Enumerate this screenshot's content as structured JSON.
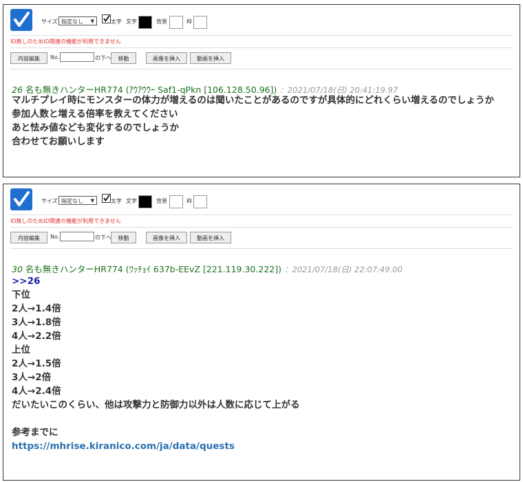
{
  "toolbar": {
    "size_label": "サイズ",
    "size_value": "指定なし",
    "bold_label": "太字",
    "text_label": "文字",
    "bg_label": "背景",
    "border_label": "枠",
    "warning": "ID無しのためID関連の機能が利用できません",
    "edit_button": "内容編集",
    "no_label": "No.",
    "below_label": "の下へ",
    "move_button": "移動",
    "insert_image_button": "画像を挿入",
    "insert_video_button": "動画を挿入"
  },
  "colors": {
    "text_swatch": "#000000",
    "bg_swatch": "#ffffff",
    "border_swatch": "#ffffff",
    "name": "#1a6f1a",
    "warning": "#e03030",
    "logo": "#1e6fd0"
  },
  "posts": [
    {
      "number": "26",
      "author": "名も無きハンターHR774 (ｱｳｱｳｳｰ Saf1-qPkn [106.128.50.96])",
      "date": "：2021/07/18(日) 20:41:19.97",
      "lines": [
        "マルチプレイ時にモンスターの体力が増えるのは聞いたことがあるのですが具体的にどれくらい増えるのでしょうか",
        "参加人数と増える倍率を教えてください",
        "あと怯み値なども変化するのでしょうか",
        "合わせてお願いします"
      ]
    },
    {
      "number": "30",
      "author": "名も無きハンターHR774 (ﾜｯﾁｮｲ 637b-EEvZ [221.119.30.222])",
      "date": "：2021/07/18(日) 22:07:49.00",
      "anchor": ">>26",
      "lines": [
        "下位",
        "2人→1.4倍",
        "3人→1.8倍",
        "4人→2.2倍",
        "上位",
        "2人→1.5倍",
        "3人→2倍",
        "4人→2.4倍",
        "だいたいこのくらい、他は攻撃力と防御力以外は人数に応じて上がる",
        "",
        "参考までに"
      ],
      "link": "https://mhrise.kiranico.com/ja/data/quests"
    }
  ]
}
